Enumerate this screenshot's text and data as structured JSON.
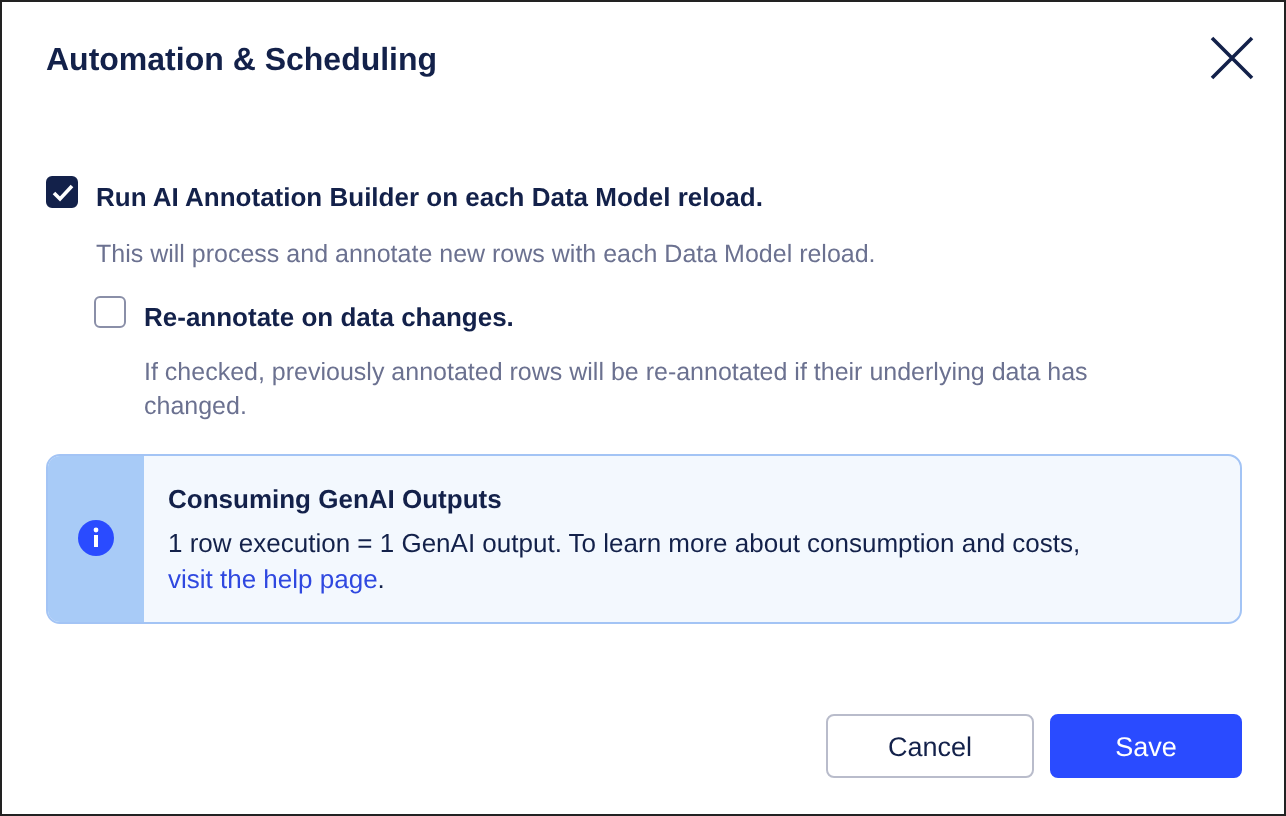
{
  "dialog": {
    "title": "Automation & Scheduling"
  },
  "options": [
    {
      "label": "Run AI Annotation Builder on each Data Model reload.",
      "description": "This will process and annotate new rows with each Data Model reload.",
      "checked": true,
      "children": [
        {
          "label": "Re-annotate on data changes.",
          "description": "If checked, previously annotated rows will be re-annotated if their underlying data has changed.",
          "checked": false
        }
      ]
    }
  ],
  "info": {
    "title": "Consuming GenAI Outputs",
    "text_before": "1 row execution = 1 GenAI output. To learn more about consumption and costs, ",
    "link": "visit the help page",
    "text_after": "."
  },
  "buttons": [
    {
      "label": "Cancel",
      "kind": "secondary"
    },
    {
      "label": "Save",
      "kind": "primary"
    }
  ]
}
